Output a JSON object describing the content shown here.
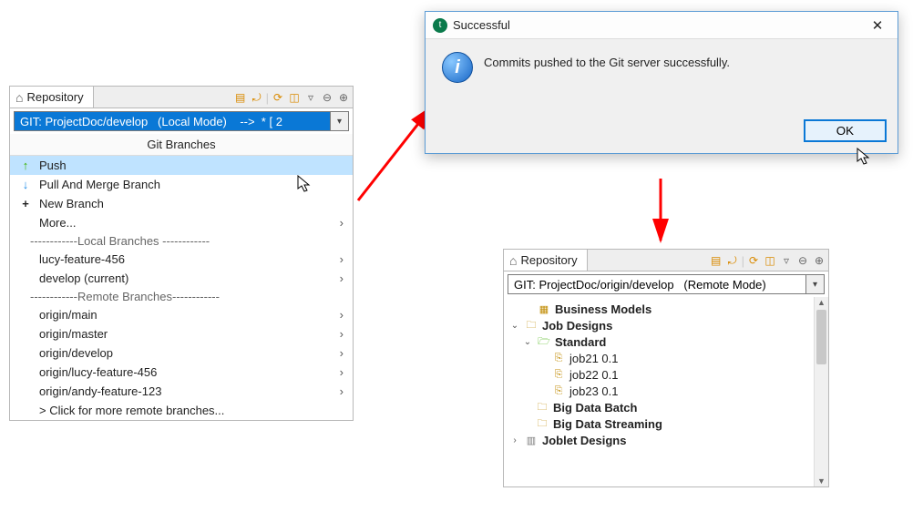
{
  "leftPanel": {
    "tabLabel": "Repository",
    "tools": [
      "collapse-icon",
      "refresh-icon",
      "sync-icon",
      "filter-icon",
      "menu-icon",
      "minimize-icon",
      "maximize-icon"
    ],
    "selector": "GIT: ProjectDoc/develop   (Local Mode)    -->  * [ 2",
    "menuHeader": "Git Branches",
    "items": {
      "push": "Push",
      "pull": "Pull And Merge Branch",
      "newBranch": "New Branch",
      "more": "More...",
      "localHeader": "------------Local   Branches ------------",
      "local1": "lucy-feature-456",
      "local2": "develop (current)",
      "remoteHeader": "------------Remote Branches------------",
      "remote1": "origin/main",
      "remote2": "origin/master",
      "remote3": "origin/develop",
      "remote4": "origin/lucy-feature-456",
      "remote5": "origin/andy-feature-123",
      "moreRemote": "> Click for more remote branches..."
    }
  },
  "dialog": {
    "title": "Successful",
    "message": "Commits pushed to the Git server successfully.",
    "okLabel": "OK"
  },
  "rightPanel": {
    "tabLabel": "Repository",
    "selector": "GIT: ProjectDoc/origin/develop   (Remote Mode)",
    "tree": {
      "n0": "Business Models",
      "n1": "Job Designs",
      "n2": "Standard",
      "n3": "job21 0.1",
      "n4": "job22 0.1",
      "n5": "job23 0.1",
      "n6": "Big Data Batch",
      "n7": "Big Data Streaming",
      "n8": "Joblet Designs"
    }
  }
}
